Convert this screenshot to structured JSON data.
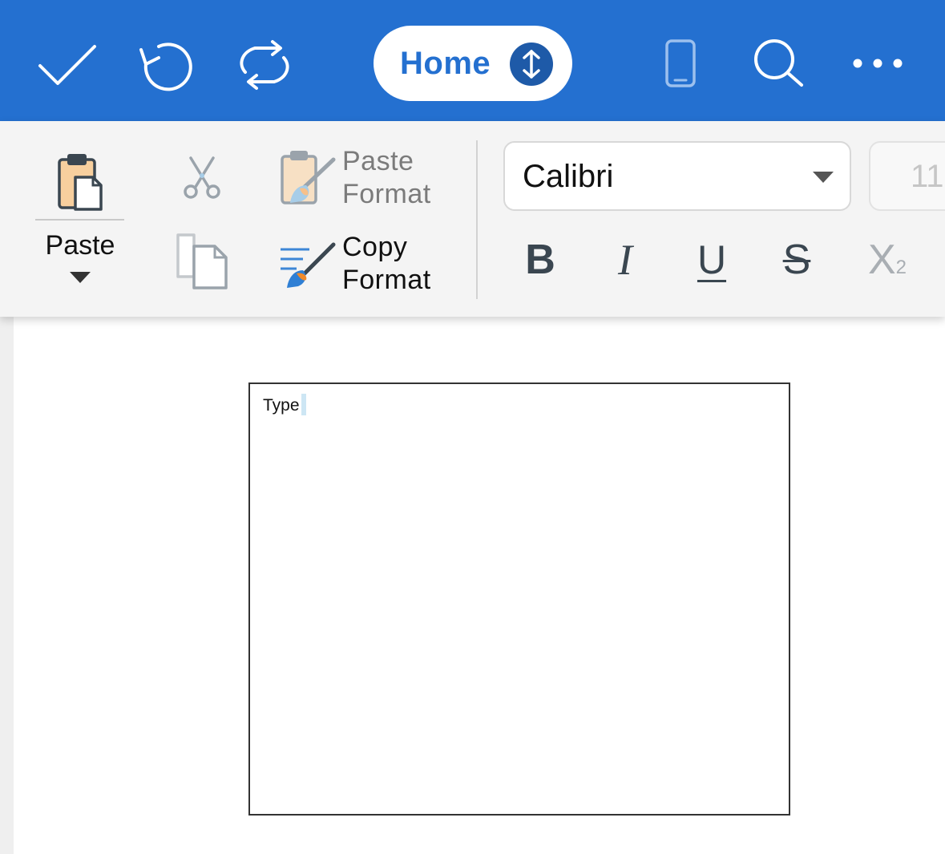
{
  "colors": {
    "accent": "#2470d0",
    "ribbon_bg": "#f4f4f4"
  },
  "topbar": {
    "confirm_icon": "checkmark-icon",
    "undo_icon": "undo-icon",
    "redo_icon": "redo-icon",
    "tab_label": "Home",
    "tab_switch_icon": "up-down-arrow-icon",
    "device_icon": "phone-icon",
    "search_icon": "search-icon",
    "more_icon": "more-icon"
  },
  "ribbon": {
    "paste_label": "Paste",
    "cut_icon": "scissors-icon",
    "copy_icon": "copy-icon",
    "paste_format_line1": "Paste",
    "paste_format_line2": "Format",
    "copy_format_line1": "Copy",
    "copy_format_line2": "Format",
    "font_name": "Calibri",
    "font_size": "11",
    "bold_label": "B",
    "italic_label": "I",
    "underline_label": "U",
    "strikethrough_label": "S",
    "subscript_label": "X",
    "subscript_small": "2"
  },
  "document": {
    "textbox_text": "Type"
  }
}
